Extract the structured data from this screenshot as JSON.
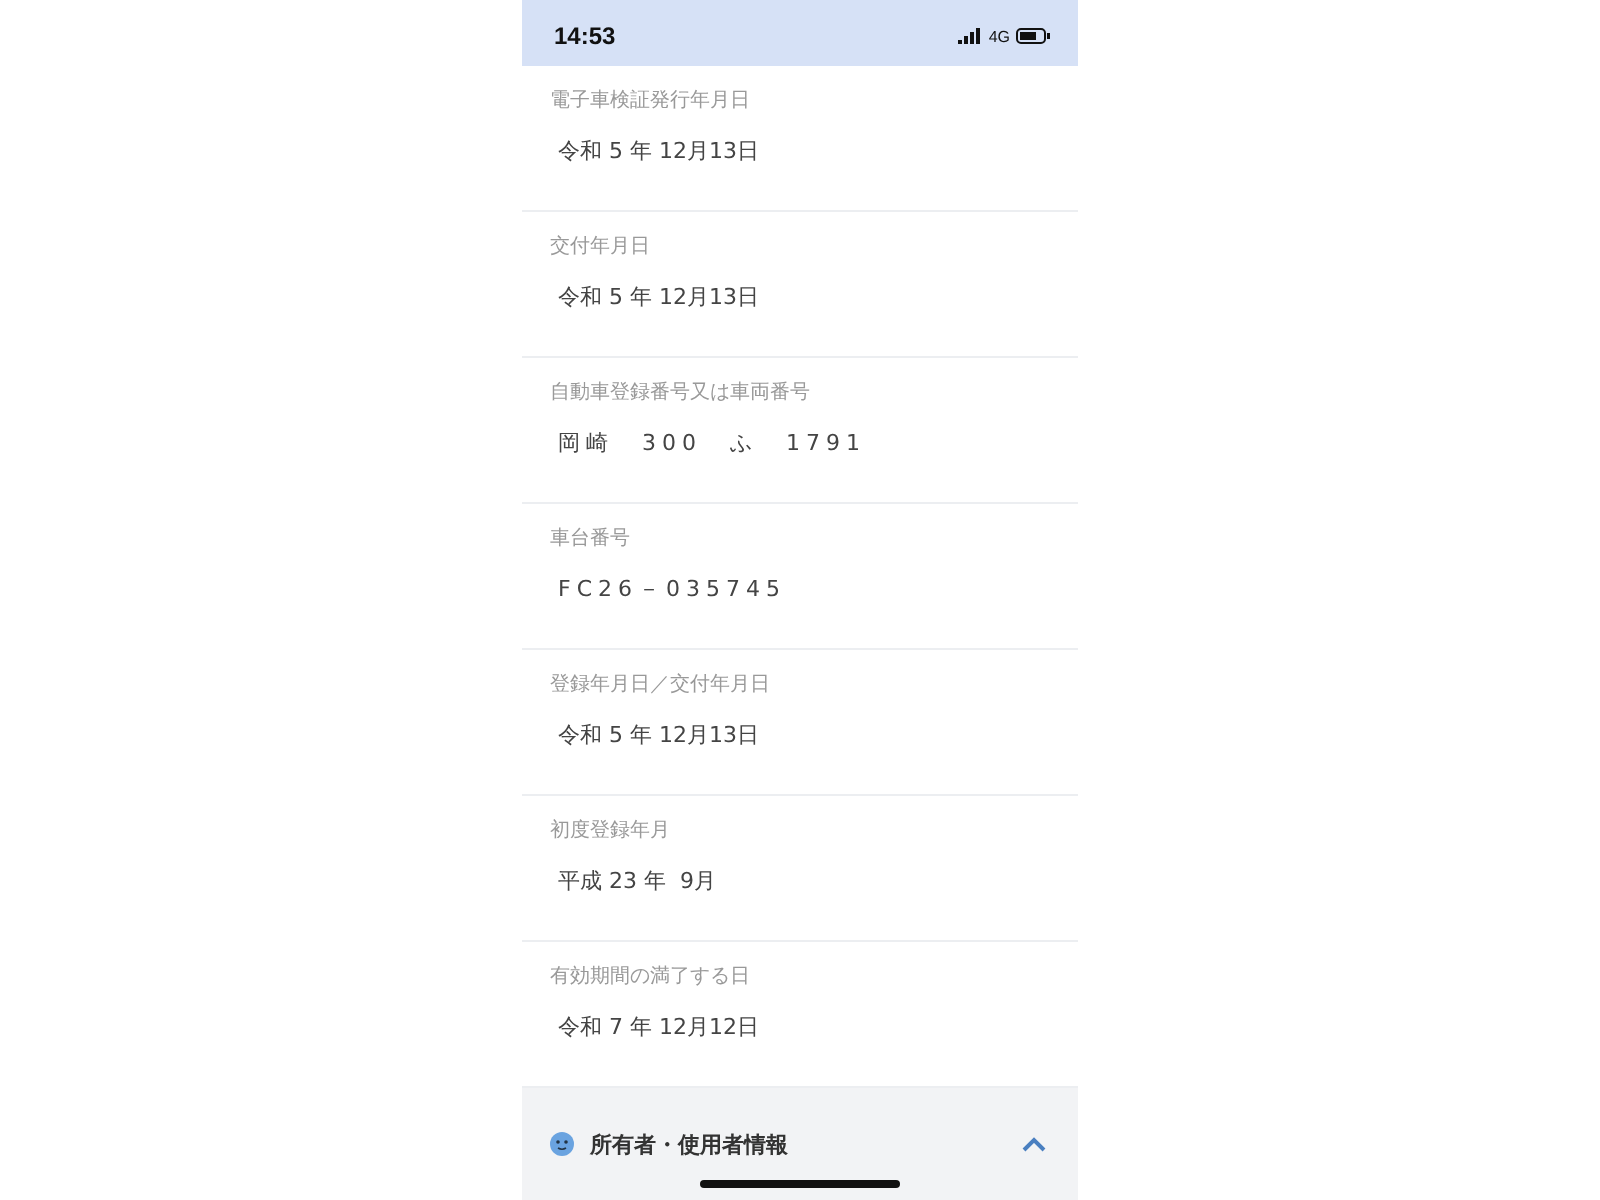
{
  "status_bar": {
    "time": "14:53",
    "network": "4G"
  },
  "fields": [
    {
      "label": "電子車検証発行年月日",
      "value": "令和 5 年 12月13日",
      "spaced": false
    },
    {
      "label": "交付年月日",
      "value": "令和 5 年 12月13日",
      "spaced": false
    },
    {
      "label": "自動車登録番号又は車両番号",
      "value": "岡崎　300　ふ　1791",
      "spaced": true
    },
    {
      "label": "車台番号",
      "value": "FC26－035745",
      "spaced": true
    },
    {
      "label": "登録年月日／交付年月日",
      "value": "令和 5 年 12月13日",
      "spaced": false
    },
    {
      "label": "初度登録年月",
      "value": "平成 23 年  9月",
      "spaced": false
    },
    {
      "label": "有効期間の満了する日",
      "value": "令和 7 年 12月12日",
      "spaced": false
    }
  ],
  "section": {
    "title": "所有者・使用者情報",
    "expanded": true
  }
}
